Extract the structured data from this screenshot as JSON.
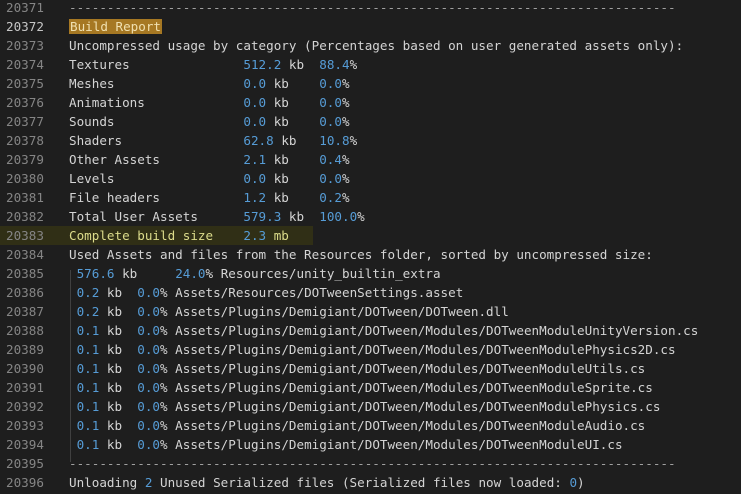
{
  "lines": [
    {
      "n": "20371",
      "parts": [
        {
          "t": "--------------------------------------------------------------------------------",
          "c": "dash"
        }
      ]
    },
    {
      "n": "20372",
      "active": true,
      "parts": [
        {
          "t": "Build Report",
          "c": "tag"
        }
      ]
    },
    {
      "n": "20373",
      "parts": [
        {
          "t": "Uncompressed usage by category (Percentages based on user generated assets only):"
        }
      ]
    },
    {
      "n": "20374",
      "parts": [
        {
          "t": "Textures               "
        },
        {
          "t": "512.2",
          "c": "num"
        },
        {
          "t": " kb  "
        },
        {
          "t": "88.4",
          "c": "num"
        },
        {
          "t": "%"
        }
      ]
    },
    {
      "n": "20375",
      "parts": [
        {
          "t": "Meshes                 "
        },
        {
          "t": "0.0",
          "c": "num"
        },
        {
          "t": " kb    "
        },
        {
          "t": "0.0",
          "c": "num"
        },
        {
          "t": "%"
        }
      ]
    },
    {
      "n": "20376",
      "parts": [
        {
          "t": "Animations             "
        },
        {
          "t": "0.0",
          "c": "num"
        },
        {
          "t": " kb    "
        },
        {
          "t": "0.0",
          "c": "num"
        },
        {
          "t": "%"
        }
      ]
    },
    {
      "n": "20377",
      "parts": [
        {
          "t": "Sounds                 "
        },
        {
          "t": "0.0",
          "c": "num"
        },
        {
          "t": " kb    "
        },
        {
          "t": "0.0",
          "c": "num"
        },
        {
          "t": "%"
        }
      ]
    },
    {
      "n": "20378",
      "parts": [
        {
          "t": "Shaders                "
        },
        {
          "t": "62.8",
          "c": "num"
        },
        {
          "t": " kb   "
        },
        {
          "t": "10.8",
          "c": "num"
        },
        {
          "t": "%"
        }
      ]
    },
    {
      "n": "20379",
      "parts": [
        {
          "t": "Other Assets           "
        },
        {
          "t": "2.1",
          "c": "num"
        },
        {
          "t": " kb    "
        },
        {
          "t": "0.4",
          "c": "num"
        },
        {
          "t": "%"
        }
      ]
    },
    {
      "n": "20380",
      "parts": [
        {
          "t": "Levels                 "
        },
        {
          "t": "0.0",
          "c": "num"
        },
        {
          "t": " kb    "
        },
        {
          "t": "0.0",
          "c": "num"
        },
        {
          "t": "%"
        }
      ]
    },
    {
      "n": "20381",
      "parts": [
        {
          "t": "File headers           "
        },
        {
          "t": "1.2",
          "c": "num"
        },
        {
          "t": " kb    "
        },
        {
          "t": "0.2",
          "c": "num"
        },
        {
          "t": "%"
        }
      ]
    },
    {
      "n": "20382",
      "parts": [
        {
          "t": "Total User Assets      "
        },
        {
          "t": "579.3",
          "c": "num"
        },
        {
          "t": " kb  "
        },
        {
          "t": "100.0",
          "c": "num"
        },
        {
          "t": "%"
        }
      ]
    },
    {
      "n": "20383",
      "hl": true,
      "parts": [
        {
          "t": "Complete build size    ",
          "c": "yellow"
        },
        {
          "t": "2.3",
          "c": "num"
        },
        {
          "t": " mb",
          "c": "yellow"
        }
      ]
    },
    {
      "n": "20384",
      "parts": [
        {
          "t": "Used Assets and files from the Resources folder, sorted by uncompressed size:"
        }
      ]
    },
    {
      "n": "20385",
      "parts": [
        {
          "t": " "
        },
        {
          "t": "576.6",
          "c": "num"
        },
        {
          "t": " kb     "
        },
        {
          "t": "24.0",
          "c": "num"
        },
        {
          "t": "% Resources/unity_builtin_extra"
        }
      ]
    },
    {
      "n": "20386",
      "parts": [
        {
          "t": " "
        },
        {
          "t": "0.2",
          "c": "num"
        },
        {
          "t": " kb  "
        },
        {
          "t": "0.0",
          "c": "num"
        },
        {
          "t": "% Assets/Resources/DOTweenSettings.asset"
        }
      ]
    },
    {
      "n": "20387",
      "parts": [
        {
          "t": " "
        },
        {
          "t": "0.2",
          "c": "num"
        },
        {
          "t": " kb  "
        },
        {
          "t": "0.0",
          "c": "num"
        },
        {
          "t": "% Assets/Plugins/Demigiant/DOTween/DOTween.dll"
        }
      ]
    },
    {
      "n": "20388",
      "parts": [
        {
          "t": " "
        },
        {
          "t": "0.1",
          "c": "num"
        },
        {
          "t": " kb  "
        },
        {
          "t": "0.0",
          "c": "num"
        },
        {
          "t": "% Assets/Plugins/Demigiant/DOTween/Modules/DOTweenModuleUnityVersion.cs"
        }
      ]
    },
    {
      "n": "20389",
      "parts": [
        {
          "t": " "
        },
        {
          "t": "0.1",
          "c": "num"
        },
        {
          "t": " kb  "
        },
        {
          "t": "0.0",
          "c": "num"
        },
        {
          "t": "% Assets/Plugins/Demigiant/DOTween/Modules/DOTweenModulePhysics2D.cs"
        }
      ]
    },
    {
      "n": "20390",
      "parts": [
        {
          "t": " "
        },
        {
          "t": "0.1",
          "c": "num"
        },
        {
          "t": " kb  "
        },
        {
          "t": "0.0",
          "c": "num"
        },
        {
          "t": "% Assets/Plugins/Demigiant/DOTween/Modules/DOTweenModuleUtils.cs"
        }
      ]
    },
    {
      "n": "20391",
      "parts": [
        {
          "t": " "
        },
        {
          "t": "0.1",
          "c": "num"
        },
        {
          "t": " kb  "
        },
        {
          "t": "0.0",
          "c": "num"
        },
        {
          "t": "% Assets/Plugins/Demigiant/DOTween/Modules/DOTweenModuleSprite.cs"
        }
      ]
    },
    {
      "n": "20392",
      "parts": [
        {
          "t": " "
        },
        {
          "t": "0.1",
          "c": "num"
        },
        {
          "t": " kb  "
        },
        {
          "t": "0.0",
          "c": "num"
        },
        {
          "t": "% Assets/Plugins/Demigiant/DOTween/Modules/DOTweenModulePhysics.cs"
        }
      ]
    },
    {
      "n": "20393",
      "parts": [
        {
          "t": " "
        },
        {
          "t": "0.1",
          "c": "num"
        },
        {
          "t": " kb  "
        },
        {
          "t": "0.0",
          "c": "num"
        },
        {
          "t": "% Assets/Plugins/Demigiant/DOTween/Modules/DOTweenModuleAudio.cs"
        }
      ]
    },
    {
      "n": "20394",
      "parts": [
        {
          "t": " "
        },
        {
          "t": "0.1",
          "c": "num"
        },
        {
          "t": " kb  "
        },
        {
          "t": "0.0",
          "c": "num"
        },
        {
          "t": "% Assets/Plugins/Demigiant/DOTween/Modules/DOTweenModuleUI.cs"
        }
      ]
    },
    {
      "n": "20395",
      "parts": [
        {
          "t": "--------------------------------------------------------------------------------",
          "c": "dash"
        }
      ]
    },
    {
      "n": "20396",
      "parts": [
        {
          "t": "Unloading "
        },
        {
          "t": "2",
          "c": "num"
        },
        {
          "t": " Unused Serialized files (Serialized files now loaded: "
        },
        {
          "t": "0",
          "c": "num"
        },
        {
          "t": ")"
        }
      ]
    }
  ]
}
